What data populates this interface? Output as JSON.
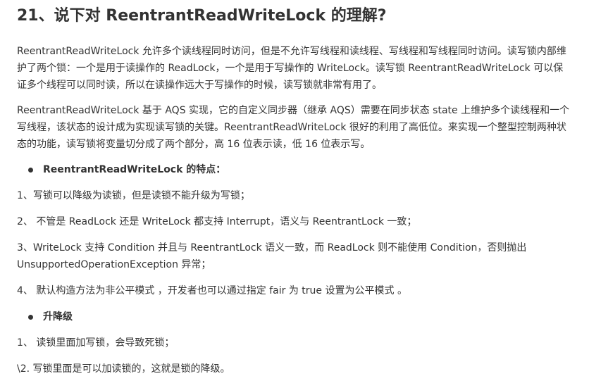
{
  "heading": "21、说下对 ReentrantReadWriteLock 的理解?",
  "para1": "ReentrantReadWriteLock 允许多个读线程同时访问，但是不允许写线程和读线程、写线程和写线程同时访问。读写锁内部维护了两个锁：一个是用于读操作的 ReadLock，一个是用于写操作的 WriteLock。读写锁 ReentrantReadWriteLock 可以保证多个线程可以同时读，所以在读操作远大于写操作的时候，读写锁就非常有用了。",
  "para2": "ReentrantReadWriteLock 基于 AQS 实现，它的自定义同步器（继承 AQS）需要在同步状态 state 上维护多个读线程和一个写线程，该状态的设计成为实现读写锁的关键。ReentrantReadWriteLock 很好的利用了高低位。来实现一个整型控制两种状态的功能，读写锁将变量切分成了两个部分，高 16 位表示读，低 16 位表示写。",
  "features_heading": "ReentrantReadWriteLock 的特点：",
  "features": [
    "1、写锁可以降级为读锁，但是读锁不能升级为写锁；",
    "2、 不管是 ReadLock 还是 WriteLock 都支持 Interrupt，语义与 ReentrantLock 一致；",
    "3、WriteLock 支持 Condition 并且与 ReentrantLock 语义一致，而 ReadLock 则不能使用 Condition，否则抛出 UnsupportedOperationException 异常；",
    "4、 默认构造方法为非公平模式 ，开发者也可以通过指定 fair 为 true 设置为公平模式 。"
  ],
  "upgrade_heading": "升降级",
  "upgrade_items": [
    "1、 读锁里面加写锁，会导致死锁；",
    "\\2. 写锁里面是可以加读锁的，这就是锁的降级。"
  ]
}
